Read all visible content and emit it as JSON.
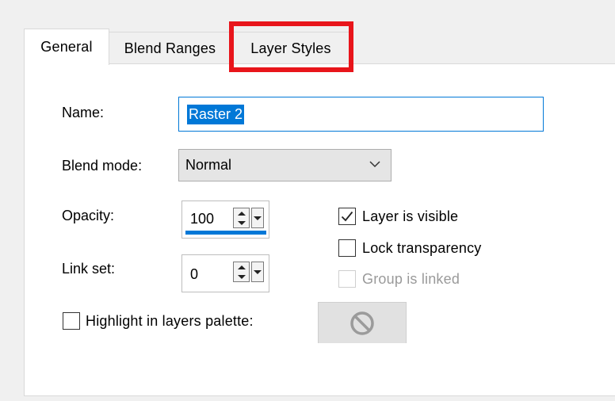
{
  "tabs": {
    "general": "General",
    "blend_ranges": "Blend Ranges",
    "layer_styles": "Layer Styles"
  },
  "form": {
    "name_label": "Name:",
    "name_value": "Raster 2",
    "blend_mode_label": "Blend mode:",
    "blend_mode_value": "Normal",
    "opacity_label": "Opacity:",
    "opacity_value": "100",
    "opacity_fraction": 1.0,
    "link_set_label": "Link set:",
    "link_set_value": "0"
  },
  "options": {
    "layer_visible": "Layer is visible",
    "lock_transparency": "Lock transparency",
    "group_linked": "Group is linked",
    "highlight_palette": "Highlight in layers palette:"
  },
  "colors": {
    "accent": "#0078d7",
    "highlight_box": "#e8151b",
    "disabled_text": "#9a9a9a"
  },
  "icons": {
    "swatch": "no-symbol-icon",
    "blend_dropdown": "chevron-down-icon"
  }
}
